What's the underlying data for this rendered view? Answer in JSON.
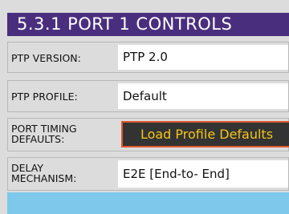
{
  "header": {
    "title": "5.3.1  PORT 1 CONTROLS"
  },
  "rows": [
    {
      "label": "PTP VERSION:",
      "value": "PTP 2.0"
    },
    {
      "label": "PTP PROFILE:",
      "value": "Default"
    },
    {
      "label_line1": "PORT TIMING",
      "label_line2": "DEFAULTS:",
      "button": "Load Profile Defaults"
    },
    {
      "label_line1": "DELAY",
      "label_line2": "MECHANISM:",
      "value": "E2E [End-to- End]"
    }
  ],
  "colors": {
    "header_bg": "#4a2e7e",
    "button_bg": "#333333",
    "button_border": "#e0562e",
    "button_text": "#f5c518",
    "bottom_bar": "#7ec8ec"
  }
}
